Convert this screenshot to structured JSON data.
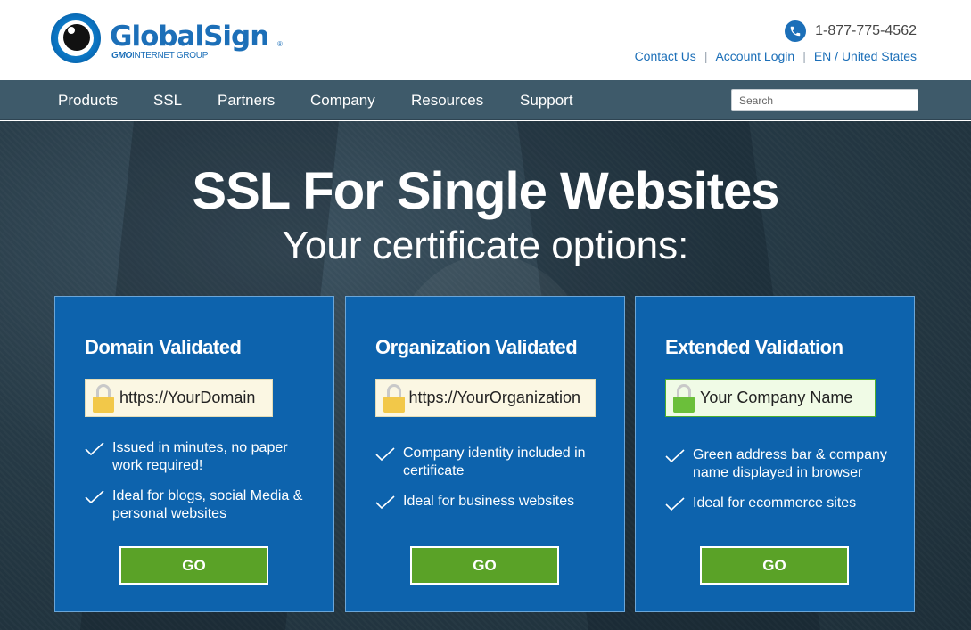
{
  "header": {
    "logo": {
      "name": "GlobalSign",
      "reg_mark": "®",
      "tag_bold": "GMO",
      "tag_rest": "INTERNET GROUP"
    },
    "phone": "1-877-775-4562",
    "links": [
      {
        "label": "Contact Us"
      },
      {
        "label": "Account Login"
      },
      {
        "label": "EN / United States"
      }
    ],
    "separator": "|"
  },
  "nav": {
    "items": [
      {
        "label": "Products"
      },
      {
        "label": "SSL"
      },
      {
        "label": "Partners"
      },
      {
        "label": "Company"
      },
      {
        "label": "Resources"
      },
      {
        "label": "Support"
      }
    ],
    "search_placeholder": "Search"
  },
  "hero": {
    "title": "SSL For Single Websites",
    "subtitle": "Your certificate options:"
  },
  "cards": [
    {
      "title": "Domain Validated",
      "address": "https://YourDomain",
      "features": [
        "Issued in minutes, no paper work required!",
        "Ideal for blogs, social Media & personal websites"
      ],
      "button": "GO"
    },
    {
      "title": "Organization Validated",
      "address": "https://YourOrganization",
      "features": [
        "Company identity included in certificate",
        "Ideal for business websites"
      ],
      "button": "GO"
    },
    {
      "title": "Extended Validation",
      "address": "Your Company Name",
      "features": [
        "Green address bar & company name displayed in browser",
        "Ideal for ecommerce sites"
      ],
      "button": "GO"
    }
  ],
  "colors": {
    "brand_blue": "#1c6fb8",
    "nav_bg": "#3e5a6a",
    "card_bg": "#0d63ad",
    "button_green": "#5aa227",
    "lock_gold": "#f2c849",
    "lock_green": "#6bbf3a"
  }
}
